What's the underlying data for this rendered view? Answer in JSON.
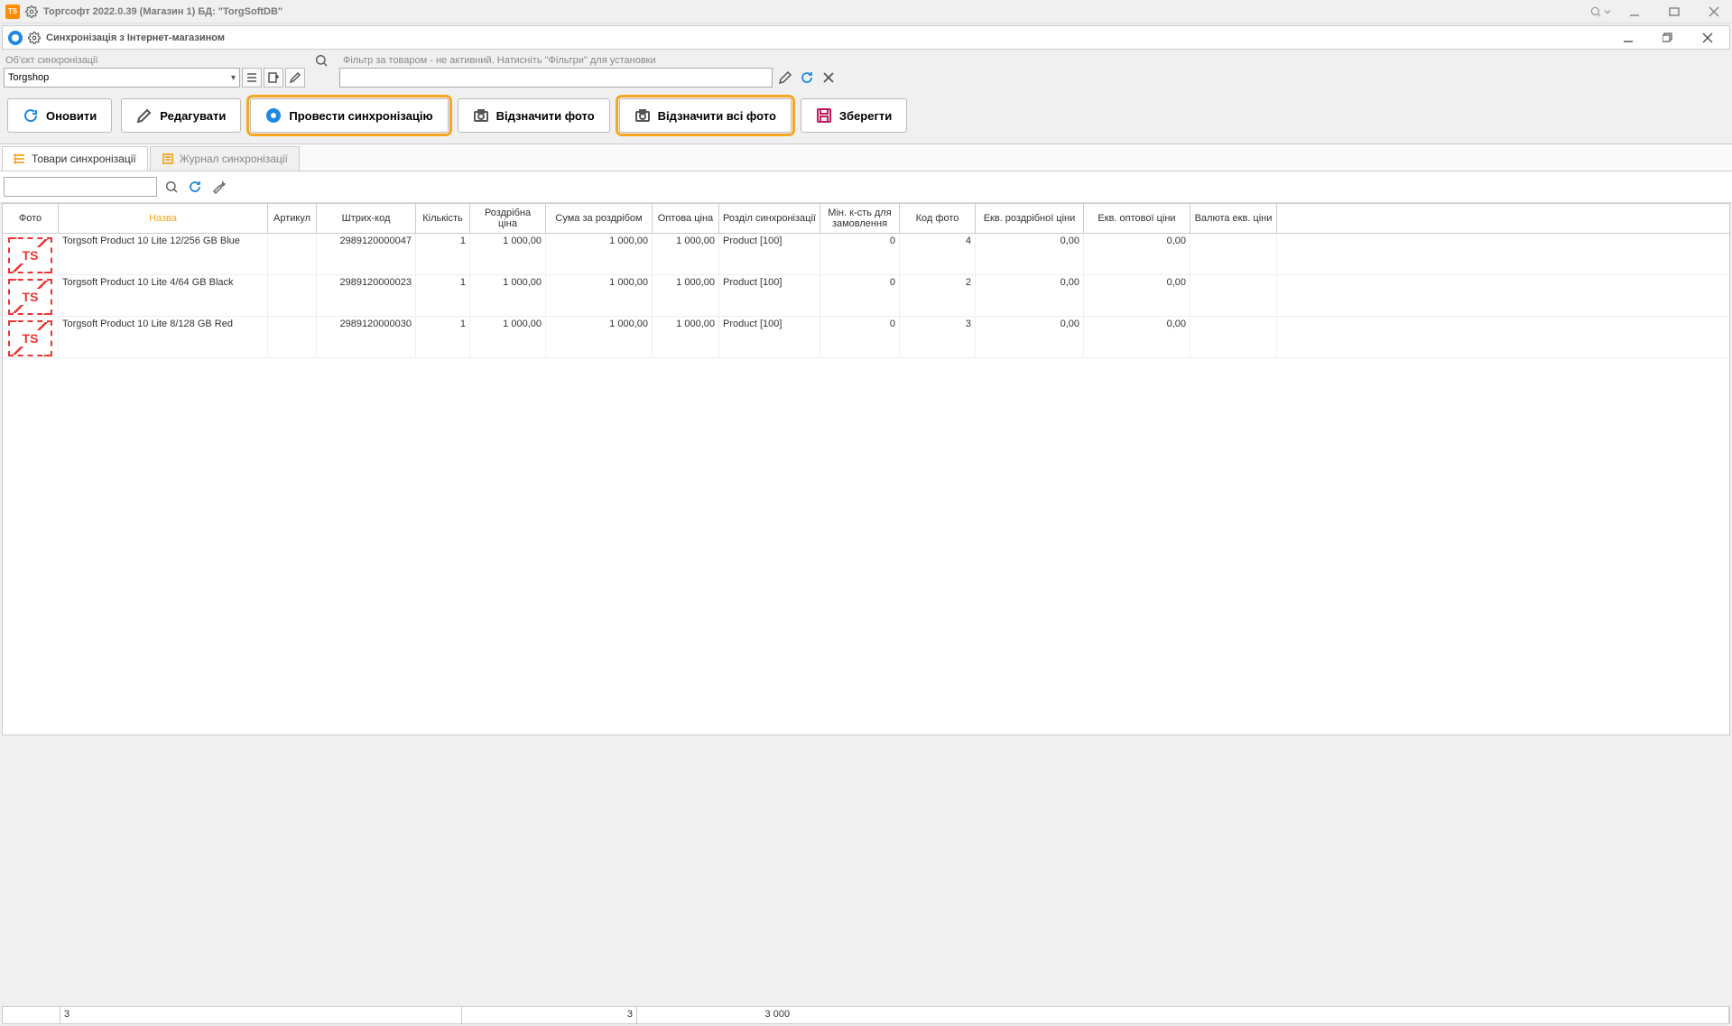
{
  "outer": {
    "title": "Торгсофт 2022.0.39 (Магазин 1) БД: \"TorgSoftDB\"",
    "logo_text": "TS"
  },
  "inner": {
    "title": "Синхронізація з Інтернет-магазином"
  },
  "objsync": {
    "label": "Об'єкт синхронізації",
    "value": "Torgshop"
  },
  "filter": {
    "hint": "Фільтр за товаром - не активний. Натисніть \"Фільтри\" для установки",
    "value": ""
  },
  "toolbar": {
    "refresh": "Оновити",
    "edit": "Редагувати",
    "sync": "Провести синхронізацію",
    "markphoto": "Відзначити фото",
    "markallphoto": "Відзначити всі фото",
    "save": "Зберегти"
  },
  "tabs": {
    "products": "Товари синхронізації",
    "journal": "Журнал синхронізації"
  },
  "columns": {
    "photo": "Фото",
    "name": "Назва",
    "art": "Артикул",
    "barcode": "Штрих-код",
    "qty": "Кількість",
    "retail": "Роздрібна ціна",
    "sum": "Сума за роздрібом",
    "whole": "Оптова ціна",
    "section": "Розділ синхронізації",
    "minqty": "Мін. к-сть для замовлення",
    "photono": "Код фото",
    "eqret": "Екв. роздрібної ціни",
    "eqwh": "Екв. оптової ціни",
    "curr": "Валюта екв. ціни"
  },
  "rows": [
    {
      "name": "Torgsoft Product 10 Lite 12/256 GB Blue",
      "art": "",
      "barcode": "2989120000047",
      "qty": "1",
      "retail": "1 000,00",
      "sum": "1 000,00",
      "whole": "1 000,00",
      "section": "Product  [100]",
      "minqty": "0",
      "photono": "4",
      "eqret": "0,00",
      "eqwh": "0,00",
      "curr": ""
    },
    {
      "name": "Torgsoft Product 10 Lite 4/64 GB Black",
      "art": "",
      "barcode": "2989120000023",
      "qty": "1",
      "retail": "1 000,00",
      "sum": "1 000,00",
      "whole": "1 000,00",
      "section": "Product  [100]",
      "minqty": "0",
      "photono": "2",
      "eqret": "0,00",
      "eqwh": "0,00",
      "curr": ""
    },
    {
      "name": "Torgsoft Product 10 Lite 8/128 GB Red",
      "art": "",
      "barcode": "2989120000030",
      "qty": "1",
      "retail": "1 000,00",
      "sum": "1 000,00",
      "whole": "1 000,00",
      "section": "Product  [100]",
      "minqty": "0",
      "photono": "3",
      "eqret": "0,00",
      "eqwh": "0,00",
      "curr": ""
    }
  ],
  "status": {
    "count": "3",
    "qty_total": "3",
    "sum_total": "3 000"
  }
}
